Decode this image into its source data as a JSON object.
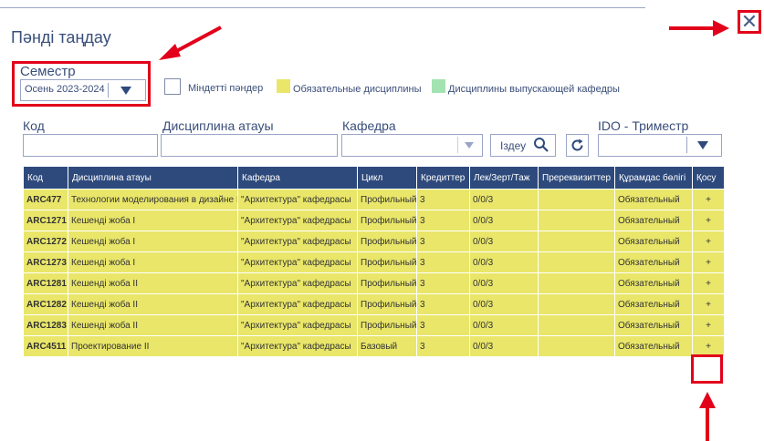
{
  "dialog": {
    "title": "Пәнді таңдау",
    "close_symbol": "✕"
  },
  "semester": {
    "label": "Семестр",
    "value": "Осень 2023-2024"
  },
  "legend": {
    "mandatory_label": "Міндетті пәндер",
    "required_label": "Обязательные дисциплины",
    "required_color": "#e9e66a",
    "department_label": "Дисциплины выпускающей кафедры",
    "department_color": "#a3e3b1"
  },
  "filters": {
    "code_label": "Код",
    "code_value": "",
    "discipline_label": "Дисциплина атауы",
    "discipline_value": "",
    "department_label": "Кафедра",
    "department_value": "",
    "search_label": "Іздеу",
    "ido_label": "IDO - Триместр",
    "ido_value": ""
  },
  "table": {
    "header_color": "#2e4a7c",
    "row_color": "#e9e66a",
    "columns": [
      "Код",
      "Дисциплина атауы",
      "Кафедра",
      "Цикл",
      "Кредиттер",
      "Лек/Зерт/Таж",
      "Пререквизиттер",
      "Құрамдас бөлігі",
      "Қосу"
    ],
    "rows": [
      {
        "code": "ARC477",
        "name": "Технологии моделирования в дизайне I",
        "department": "\"Архитектура\" кафедрасы",
        "cycle": "Профильный",
        "credits": "3",
        "hours": "0/0/3",
        "prereq": "",
        "component": "Обязательный",
        "add": "+"
      },
      {
        "code": "ARC1271",
        "name": "Кешенді жоба I",
        "department": "\"Архитектура\" кафедрасы",
        "cycle": "Профильный",
        "credits": "3",
        "hours": "0/0/3",
        "prereq": "",
        "component": "Обязательный",
        "add": "+"
      },
      {
        "code": "ARC1272",
        "name": "Кешенді жоба I",
        "department": "\"Архитектура\" кафедрасы",
        "cycle": "Профильный",
        "credits": "3",
        "hours": "0/0/3",
        "prereq": "",
        "component": "Обязательный",
        "add": "+"
      },
      {
        "code": "ARC1273",
        "name": "Кешенді жоба I",
        "department": "\"Архитектура\" кафедрасы",
        "cycle": "Профильный",
        "credits": "3",
        "hours": "0/0/3",
        "prereq": "",
        "component": "Обязательный",
        "add": "+"
      },
      {
        "code": "ARC1281",
        "name": "Кешенді жоба II",
        "department": "\"Архитектура\" кафедрасы",
        "cycle": "Профильный",
        "credits": "3",
        "hours": "0/0/3",
        "prereq": "",
        "component": "Обязательный",
        "add": "+"
      },
      {
        "code": "ARC1282",
        "name": "Кешенді жоба II",
        "department": "\"Архитектура\" кафедрасы",
        "cycle": "Профильный",
        "credits": "3",
        "hours": "0/0/3",
        "prereq": "",
        "component": "Обязательный",
        "add": "+"
      },
      {
        "code": "ARC1283",
        "name": "Кешенді жоба II",
        "department": "\"Архитектура\" кафедрасы",
        "cycle": "Профильный",
        "credits": "3",
        "hours": "0/0/3",
        "prereq": "",
        "component": "Обязательный",
        "add": "+"
      },
      {
        "code": "ARC4511",
        "name": "Проектирование II",
        "department": "\"Архитектура\" кафедрасы",
        "cycle": "Базовый",
        "credits": "3",
        "hours": "0/0/3",
        "prereq": "",
        "component": "Обязательный",
        "add": "+"
      }
    ]
  },
  "annotations": {
    "highlight_color": "#e2001a"
  }
}
